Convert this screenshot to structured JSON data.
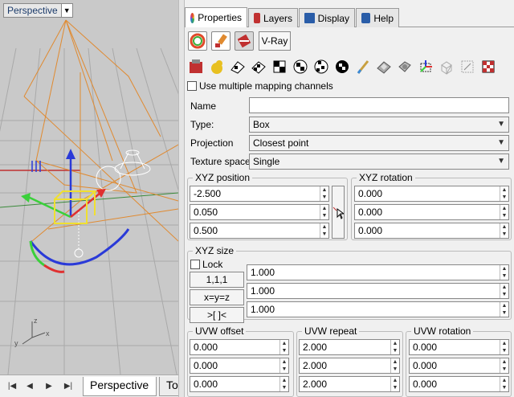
{
  "viewport": {
    "label": "Perspective",
    "dropdown_glyph": "▼"
  },
  "bottom_tabs": {
    "nav": [
      "|◀",
      "◀",
      "▶",
      "▶|"
    ],
    "tabs": [
      "Perspective",
      "To"
    ]
  },
  "panel_tabs": [
    {
      "label": "Properties",
      "icon": "color-wheel-icon",
      "color": "#e04a2a"
    },
    {
      "label": "Layers",
      "icon": "layers-icon",
      "color": "#c03030"
    },
    {
      "label": "Display",
      "icon": "display-icon",
      "color": "#2a5da8"
    },
    {
      "label": "Help",
      "icon": "help-icon",
      "color": "#2a5da8"
    }
  ],
  "toolbar": {
    "vray_label": "V-Ray"
  },
  "mapping": {
    "multi_channels_label": "Use multiple mapping channels",
    "name_label": "Name",
    "name_value": "",
    "type_label": "Type:",
    "type_value": "Box",
    "projection_label": "Projection",
    "projection_value": "Closest point",
    "texture_space_label": "Texture space",
    "texture_space_value": "Single"
  },
  "xyz_position": {
    "title": "XYZ position",
    "values": [
      "-2.500",
      "0.050",
      "0.500"
    ]
  },
  "xyz_rotation": {
    "title": "XYZ rotation",
    "values": [
      "0.000",
      "0.000",
      "0.000"
    ]
  },
  "xyz_size": {
    "title": "XYZ size",
    "lock_label": "Lock",
    "buttons": [
      "1,1,1",
      "x=y=z",
      ">[ ]<"
    ],
    "values": [
      "1.000",
      "1.000",
      "1.000"
    ]
  },
  "uvw_offset": {
    "title": "UVW offset",
    "values": [
      "0.000",
      "0.000",
      "0.000"
    ]
  },
  "uvw_repeat": {
    "title": "UVW repeat",
    "values": [
      "2.000",
      "2.000",
      "2.000"
    ]
  },
  "uvw_rotation": {
    "title": "UVW rotation",
    "values": [
      "0.000",
      "0.000",
      "0.000"
    ]
  },
  "spin_glyphs": {
    "up": "▲",
    "down": "▼"
  }
}
